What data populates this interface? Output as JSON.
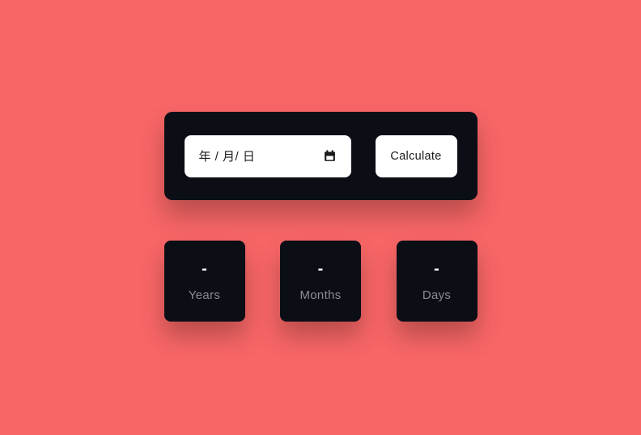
{
  "input": {
    "placeholder": "年 / 月/ 日",
    "calculate_label": "Calculate"
  },
  "results": {
    "years": {
      "value": "-",
      "label": "Years"
    },
    "months": {
      "value": "-",
      "label": "Months"
    },
    "days": {
      "value": "-",
      "label": "Days"
    }
  },
  "colors": {
    "background": "#f86666",
    "card": "#0c0e16",
    "field": "#ffffff",
    "label": "#8a8d98"
  }
}
